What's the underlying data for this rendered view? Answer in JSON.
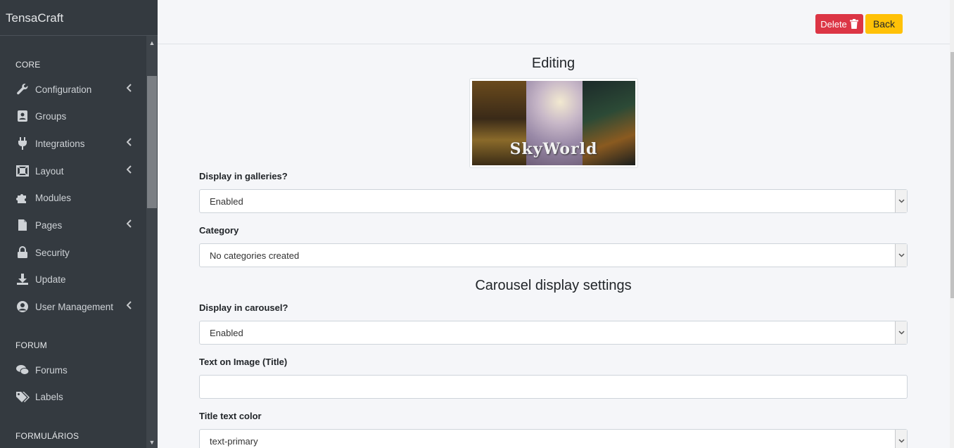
{
  "brand": "TensaCraft",
  "sidebar": {
    "sections": [
      "CORE",
      "FORUM",
      "FORMULÁRIOS"
    ],
    "items": [
      {
        "label": "Configuration",
        "icon": "wrench-icon",
        "expandable": true
      },
      {
        "label": "Groups",
        "icon": "id-card-icon",
        "expandable": false
      },
      {
        "label": "Integrations",
        "icon": "plug-icon",
        "expandable": true
      },
      {
        "label": "Layout",
        "icon": "layout-icon",
        "expandable": true
      },
      {
        "label": "Modules",
        "icon": "puzzle-icon",
        "expandable": false
      },
      {
        "label": "Pages",
        "icon": "file-icon",
        "expandable": true
      },
      {
        "label": "Security",
        "icon": "lock-icon",
        "expandable": false
      },
      {
        "label": "Update",
        "icon": "download-icon",
        "expandable": false
      },
      {
        "label": "User Management",
        "icon": "user-circle-icon",
        "expandable": true
      },
      {
        "label": "Forums",
        "icon": "comments-icon",
        "expandable": false
      },
      {
        "label": "Labels",
        "icon": "tags-icon",
        "expandable": false
      }
    ]
  },
  "toolbar": {
    "delete_label": "Delete",
    "back_label": "Back"
  },
  "editing_title": "Editing",
  "image_text": "SkyWorld",
  "fields": {
    "display_galleries": {
      "label": "Display in galleries?",
      "value": "Enabled"
    },
    "category": {
      "label": "Category",
      "value": "No categories created"
    },
    "carousel_heading": "Carousel display settings",
    "display_carousel": {
      "label": "Display in carousel?",
      "value": "Enabled"
    },
    "title_text": {
      "label": "Text on Image (Title)",
      "value": ""
    },
    "title_color": {
      "label": "Title text color",
      "value": "text-primary"
    }
  },
  "colors": {
    "sidebar": "#343a40",
    "danger": "#dc3545",
    "warning": "#ffc107",
    "page_bg": "#f5f6f9"
  }
}
